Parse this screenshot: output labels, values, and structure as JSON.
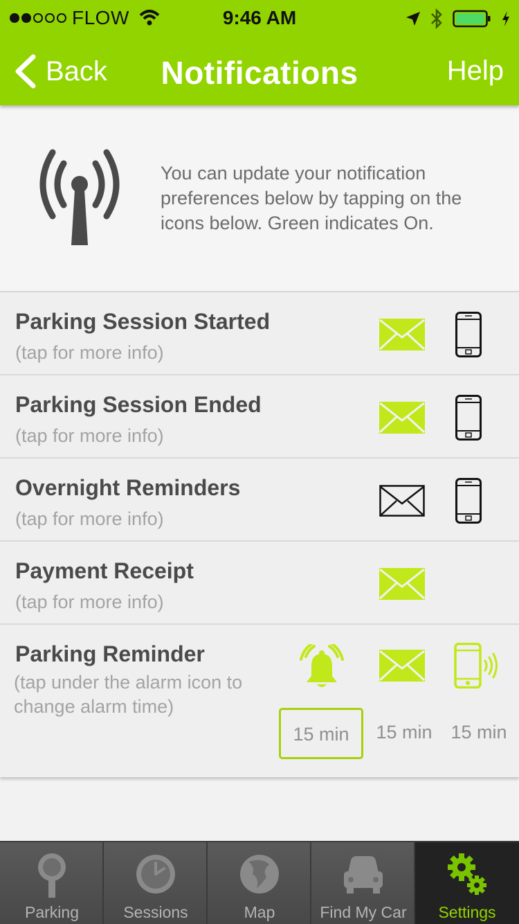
{
  "status_bar": {
    "carrier": "FLOW",
    "time": "9:46 AM",
    "signal_dots_filled": 2,
    "signal_dots_total": 5
  },
  "nav": {
    "back_label": "Back",
    "title": "Notifications",
    "help_label": "Help"
  },
  "intro": {
    "text": "You can update your notification preferences below by tapping on the icons below. Green indicates On."
  },
  "rows": [
    {
      "title": "Parking Session Started",
      "subtitle": "(tap for more info)",
      "email_on": true,
      "phone_on": false
    },
    {
      "title": "Parking Session Ended",
      "subtitle": "(tap for more info)",
      "email_on": true,
      "phone_on": false
    },
    {
      "title": "Overnight Reminders",
      "subtitle": "(tap for more info)",
      "email_on": false,
      "phone_on": false
    },
    {
      "title": "Payment Receipt",
      "subtitle": "(tap for more info)",
      "email_on": true
    },
    {
      "title": "Parking Reminder",
      "subtitle": "(tap under the alarm icon to change alarm time)",
      "alarm_on": true,
      "email_on": true,
      "phone_on": true,
      "times": [
        "15 min",
        "15 min",
        "15 min"
      ]
    }
  ],
  "tabs": [
    {
      "label": "Parking",
      "icon": "parking-meter-icon"
    },
    {
      "label": "Sessions",
      "icon": "clock-icon"
    },
    {
      "label": "Map",
      "icon": "globe-icon"
    },
    {
      "label": "Find My Car",
      "icon": "car-icon"
    },
    {
      "label": "Settings",
      "icon": "gears-icon",
      "active": true
    }
  ],
  "colors": {
    "accent": "#91d400",
    "icon_on": "#c0e81a",
    "text": "#4a4a4a"
  }
}
